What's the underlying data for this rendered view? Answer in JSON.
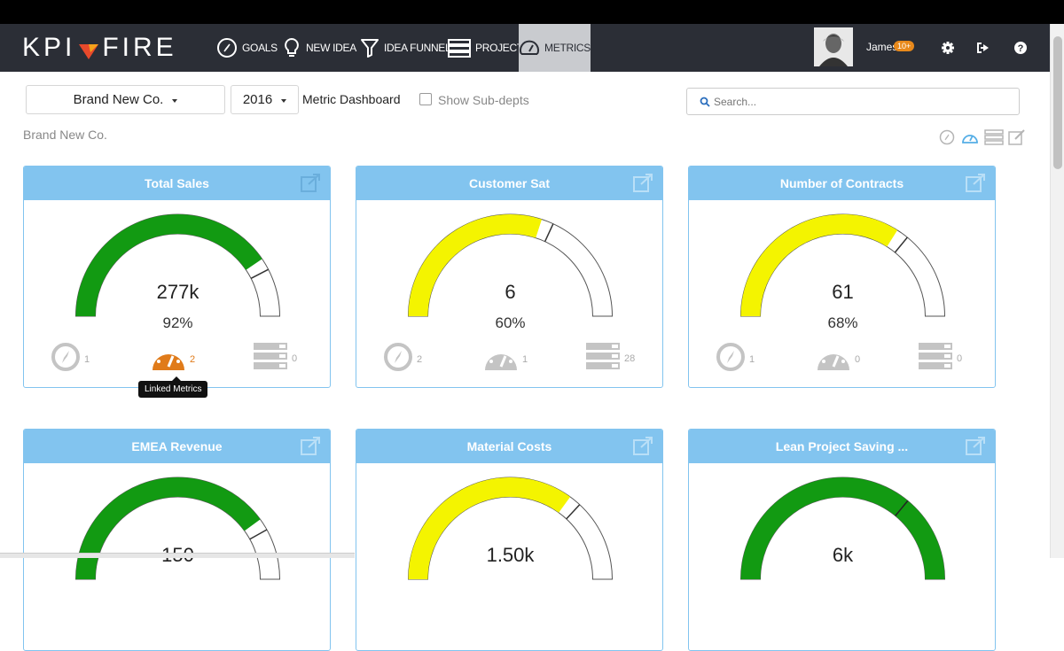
{
  "app": {
    "logo_left": "KPI",
    "logo_right": "FIRE"
  },
  "nav": {
    "items": [
      {
        "label": "GOALS",
        "icon": "compass-icon"
      },
      {
        "label": "NEW IDEA",
        "icon": "lightbulb-icon"
      },
      {
        "label": "IDEA FUNNEL",
        "icon": "funnel-icon"
      },
      {
        "label": "PROJECTS",
        "icon": "projects-icon"
      },
      {
        "label": "METRICS",
        "icon": "speedometer-icon",
        "active": true
      }
    ],
    "user_name": "James",
    "user_badge": "10+"
  },
  "toolbar": {
    "company": "Brand New Co.",
    "year": "2016",
    "dashboard_title": "Metric Dashboard",
    "subdepts_label": "Show Sub-depts",
    "search_placeholder": "Search..."
  },
  "breadcrumb": "Brand New Co.",
  "colors": {
    "nav_bg": "#2b2e36",
    "card_header": "#82c4ef",
    "green": "#129a12",
    "yellow": "#f4f400",
    "orange": "#e07b1a"
  },
  "tooltip": "Linked Metrics",
  "metrics": [
    {
      "title": "Total Sales",
      "value": "277k",
      "percent": "92%",
      "fill": 0.81,
      "color": "green",
      "goals": "1",
      "linked": "2",
      "projects": "0",
      "linked_highlight": true
    },
    {
      "title": "Customer Sat",
      "value": "6",
      "percent": "60%",
      "fill": 0.6,
      "color": "yellow",
      "goals": "2",
      "linked": "1",
      "projects": "28"
    },
    {
      "title": "Number of Contracts",
      "value": "61",
      "percent": "68%",
      "fill": 0.68,
      "color": "yellow",
      "goals": "1",
      "linked": "0",
      "projects": "0"
    },
    {
      "title": "EMEA Revenue",
      "value": "150",
      "percent": "",
      "fill": 0.8,
      "color": "green"
    },
    {
      "title": "Material Costs",
      "value": "1.50k",
      "percent": "",
      "fill": 0.7,
      "color": "yellow"
    },
    {
      "title": "Lean Project Saving ...",
      "value": "6k",
      "percent": "",
      "fill": 1.0,
      "color": "green"
    }
  ]
}
